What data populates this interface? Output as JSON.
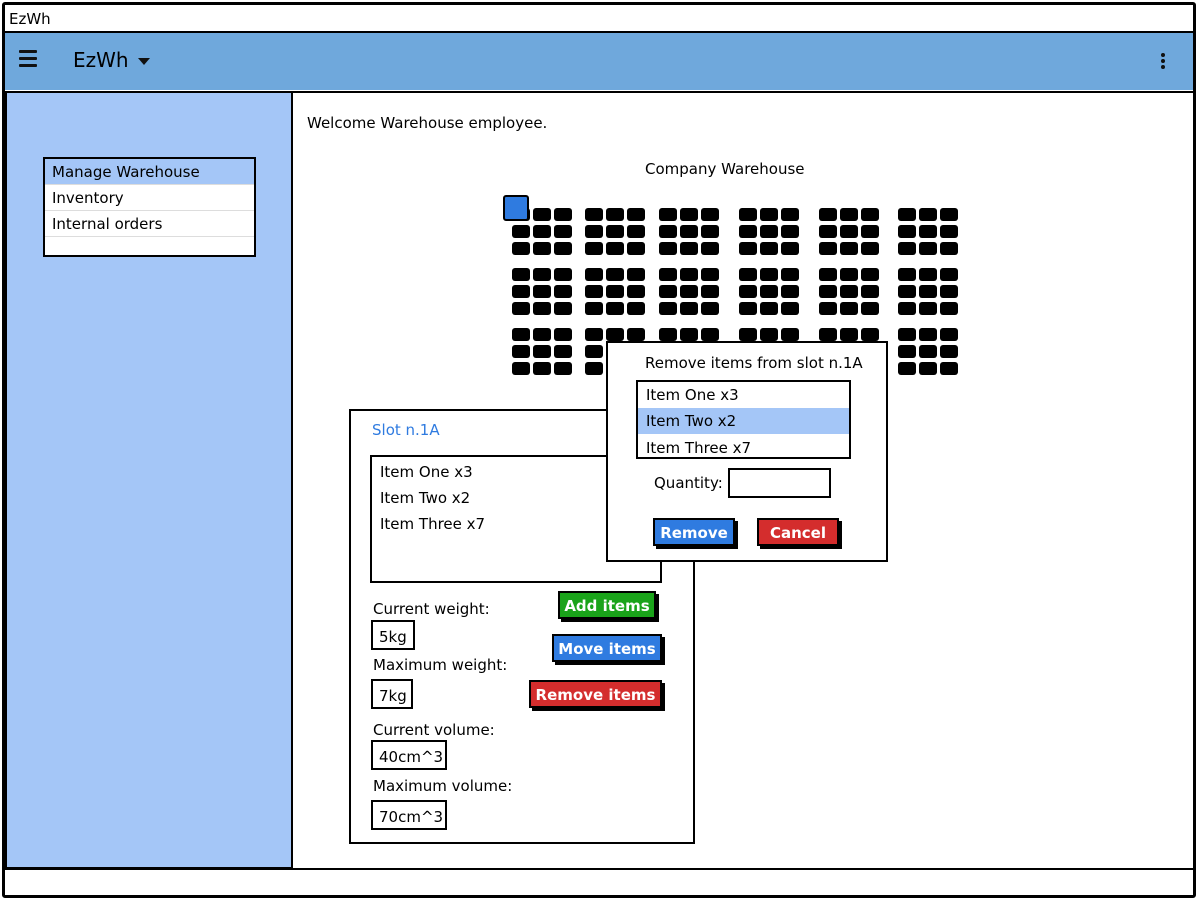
{
  "window": {
    "title": "EzWh"
  },
  "appbar": {
    "title": "EzWh",
    "menu_icon": "hamburger-icon",
    "dropdown_icon": "caret-down-icon",
    "more_icon": "kebab-icon"
  },
  "sidebar": {
    "items": [
      {
        "label": "Manage Warehouse",
        "selected": true
      },
      {
        "label": "Inventory",
        "selected": false
      },
      {
        "label": "Internal orders",
        "selected": false
      }
    ]
  },
  "main": {
    "welcome": "Welcome Warehouse employee.",
    "warehouse_title": "Company Warehouse",
    "colors": {
      "selected_slot": "#2f7be0",
      "slot": "#000000"
    }
  },
  "slot_panel": {
    "title": "Slot n.1A",
    "items": [
      "Item One x3",
      "Item Two x2",
      "Item Three x7"
    ],
    "current_weight_label": "Current weight:",
    "current_weight": "5kg",
    "maximum_weight_label": "Maximum weight:",
    "maximum_weight": "7kg",
    "current_volume_label": "Current volume:",
    "current_volume": "40cm^3",
    "maximum_volume_label": "Maximum volume:",
    "maximum_volume": "70cm^3",
    "add_label": "Add items",
    "move_label": "Move items",
    "remove_label": "Remove items"
  },
  "dialog": {
    "title": "Remove items from slot n.1A",
    "items": [
      {
        "label": "Item One x3",
        "selected": false
      },
      {
        "label": "Item Two x2",
        "selected": true
      },
      {
        "label": "Item Three x7",
        "selected": false
      }
    ],
    "quantity_label": "Quantity:",
    "quantity_value": "",
    "remove_label": "Remove",
    "cancel_label": "Cancel"
  }
}
